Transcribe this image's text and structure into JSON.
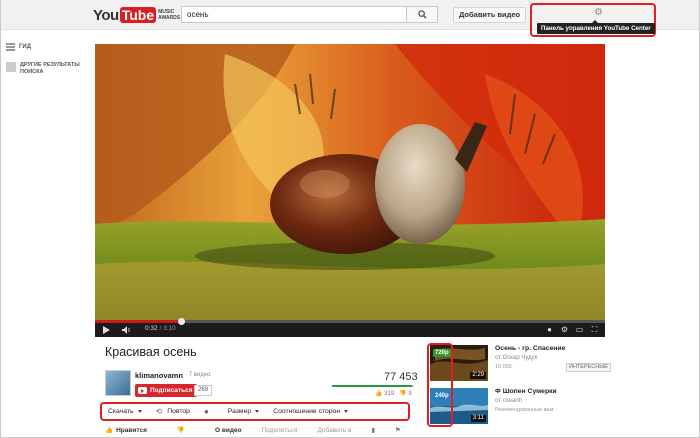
{
  "header": {
    "logo_you": "You",
    "logo_tube": "Tube",
    "logo_sub": "MUSIC AWARDS",
    "search_value": "осень",
    "upload_label": "Добавить видео",
    "tooltip": "Панель управления YouTube Center"
  },
  "sidebar": {
    "guide_label": "ГИД",
    "other_label": "ДРУГИЕ РЕЗУЛЬТАТЫ ПОИСКА"
  },
  "player": {
    "time_current": "0:32",
    "time_duration": "3:10",
    "progress": 0.168
  },
  "video": {
    "title": "Красивая осень",
    "channel": "klimanovamn",
    "video_count": "· 7 видео",
    "subscribe_label": "Подписаться",
    "subscriber_count": "269",
    "views": "77 453",
    "likes": "319",
    "dislikes": "9",
    "like_ratio": 0.97
  },
  "toolbar": {
    "download": "Скачать",
    "repeat": "Повтор",
    "size": "Размер",
    "aspect": "Соотношение сторон"
  },
  "actions": {
    "like": "Нравится",
    "about": "О видео",
    "share": "Поделиться",
    "add": "Добавить в"
  },
  "related": [
    {
      "quality": "720p",
      "duration": "2:29",
      "title": "Осень - гр. Спасение",
      "author": "от Оскар Чудук",
      "views": "10 055",
      "badge": "ИНТЕРЕСНЫЕ"
    },
    {
      "quality": "240p",
      "duration": "3:11",
      "title": "Ф Шопен Сумерки",
      "author": "от cxearth",
      "views": "Рекомендованные вам",
      "badge": ""
    }
  ],
  "colors": {
    "accent_red": "#d8262c",
    "highlight": "#e02020",
    "quality_green": "#2e9a2e"
  }
}
